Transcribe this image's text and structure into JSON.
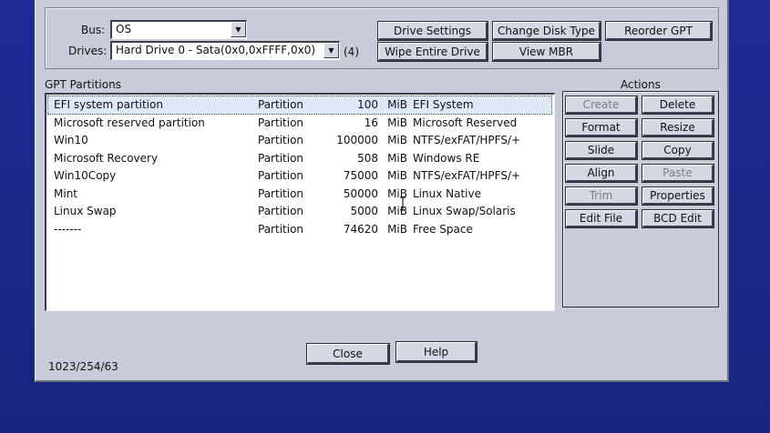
{
  "top": {
    "bus_label": "Bus:",
    "bus_value": "OS",
    "drives_label": "Drives:",
    "drives_value": "Hard Drive 0 - Sata(0x0,0xFFFF,0x0)",
    "drives_count": "(4)",
    "buttons": {
      "drive_settings": "Drive Settings",
      "change_disk_type": "Change Disk Type",
      "reorder_gpt": "Reorder GPT",
      "wipe_entire_drive": "Wipe Entire Drive",
      "view_mbr": "View MBR"
    }
  },
  "partitions": {
    "label": "GPT Partitions",
    "rows": [
      {
        "name": "EFI system partition",
        "type": "Partition",
        "size": "100",
        "unit": "MiB",
        "fs": "EFI System",
        "selected": true
      },
      {
        "name": "Microsoft reserved partition",
        "type": "Partition",
        "size": "16",
        "unit": "MiB",
        "fs": "Microsoft Reserved",
        "selected": false
      },
      {
        "name": "Win10",
        "type": "Partition",
        "size": "100000",
        "unit": "MiB",
        "fs": "NTFS/exFAT/HPFS/+",
        "selected": false
      },
      {
        "name": "Microsoft Recovery",
        "type": "Partition",
        "size": "508",
        "unit": "MiB",
        "fs": "Windows RE",
        "selected": false
      },
      {
        "name": "Win10Copy",
        "type": "Partition",
        "size": "75000",
        "unit": "MiB",
        "fs": "NTFS/exFAT/HPFS/+",
        "selected": false
      },
      {
        "name": "Mint",
        "type": "Partition",
        "size": "50000",
        "unit": "MiB",
        "fs": "Linux Native",
        "selected": false
      },
      {
        "name": "Linux Swap",
        "type": "Partition",
        "size": "5000",
        "unit": "MiB",
        "fs": "Linux Swap/Solaris",
        "selected": false
      },
      {
        "name": "-------",
        "type": "Partition",
        "size": "74620",
        "unit": "MiB",
        "fs": "Free Space",
        "selected": false
      }
    ]
  },
  "actions": {
    "label": "Actions",
    "create": "Create",
    "delete": "Delete",
    "format": "Format",
    "resize": "Resize",
    "slide": "Slide",
    "copy": "Copy",
    "align": "Align",
    "paste": "Paste",
    "trim": "Trim",
    "properties": "Properties",
    "edit_file": "Edit File",
    "bcd_edit": "BCD Edit"
  },
  "footer": {
    "close": "Close",
    "help": "Help",
    "status": "1023/254/63"
  }
}
